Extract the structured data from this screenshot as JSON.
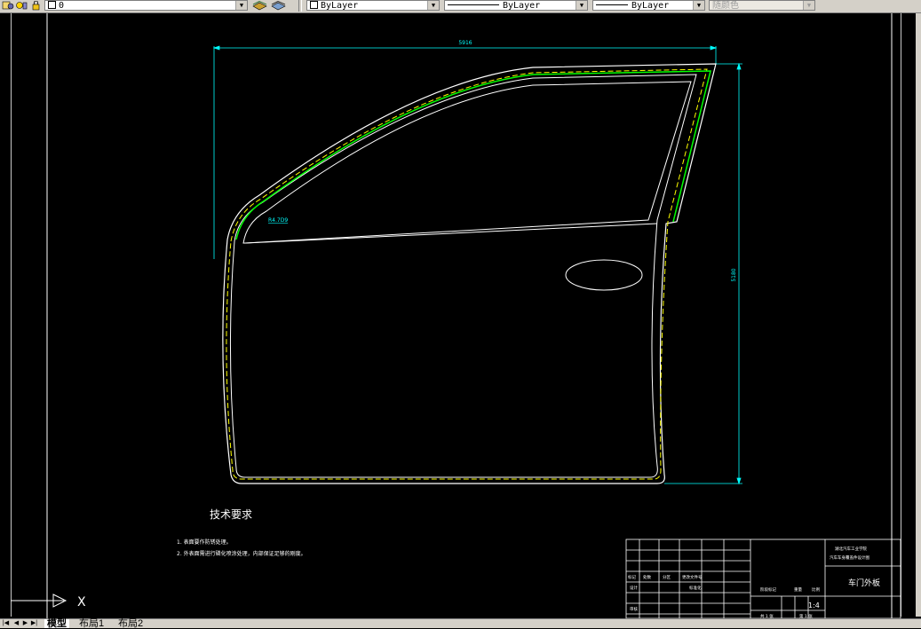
{
  "toolbar": {
    "layer_name": "0",
    "color_value": "ByLayer",
    "linetype_value": "ByLayer",
    "lineweight_value": "ByLayer",
    "plotstyle_value": "随颜色"
  },
  "drawing": {
    "dim_width": "5916",
    "dim_height": "5180",
    "radius_label": "R4.7D9",
    "tech_title": "技术要求",
    "tech_items": [
      "1. 表面要作防锈处理。",
      "2. 外表面需进行磷化喷涂处理，内部保证足够的刚度。"
    ],
    "ucs_label": "X"
  },
  "title_block": {
    "institution_line1": "湖北汽车工业学院",
    "institution_line2": "汽车车身覆盖件设计图",
    "part_name": "车门外板",
    "scale": "1:4",
    "col_labels": [
      "标记",
      "处数",
      "分区",
      "更改文件号"
    ],
    "row_labels": [
      "设计",
      "审核"
    ],
    "stage_label": "阶段标记",
    "weight_label": "重量",
    "scale_label": "比例",
    "sheet_total": "共 1 张",
    "sheet_no": "第 1 张",
    "std_label": "标准化"
  },
  "tabs": {
    "items": [
      "模型",
      "布局1",
      "布局2"
    ],
    "active": "模型"
  },
  "colors": {
    "background": "#000000",
    "outline": "#ffffff",
    "hidden_line": "#ffff00",
    "accent_green": "#00ff00",
    "dimension": "#00ffff",
    "ui_face": "#d4d0c8"
  }
}
